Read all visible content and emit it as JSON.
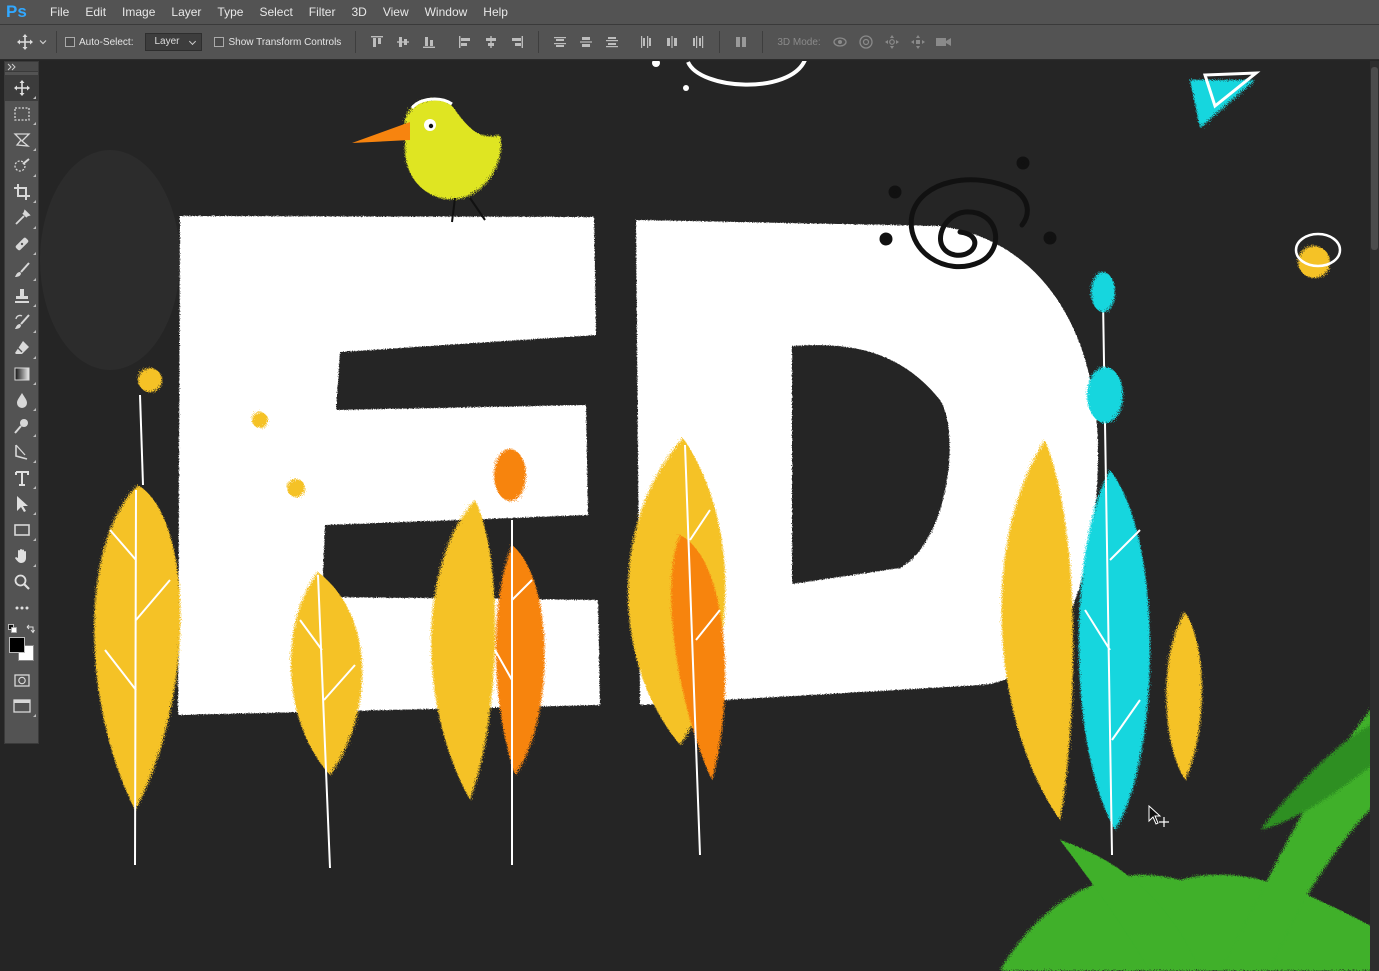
{
  "app": {
    "logo_text": "Ps",
    "accent_color": "#31a8ff"
  },
  "menubar": {
    "items": [
      "File",
      "Edit",
      "Image",
      "Layer",
      "Type",
      "Select",
      "Filter",
      "3D",
      "View",
      "Window",
      "Help"
    ]
  },
  "options": {
    "auto_select_label": "Auto-Select:",
    "auto_select_checked": false,
    "layer_select_value": "Layer",
    "show_transform_label": "Show Transform Controls",
    "show_transform_checked": false,
    "mode_3d_label": "3D Mode:"
  },
  "toolbox": {
    "tools": [
      "move-tool-icon",
      "marquee-tool-icon",
      "lasso-tool-icon",
      "quick-select-tool-icon",
      "crop-tool-icon",
      "eyedropper-tool-icon",
      "healing-brush-tool-icon",
      "brush-tool-icon",
      "clone-stamp-tool-icon",
      "history-brush-tool-icon",
      "eraser-tool-icon",
      "gradient-tool-icon",
      "blur-tool-icon",
      "dodge-tool-icon",
      "pen-tool-icon",
      "type-tool-icon",
      "path-select-tool-icon",
      "rectangle-tool-icon",
      "hand-tool-icon",
      "zoom-tool-icon",
      "more-tools-icon"
    ],
    "active_tool": "move-tool-icon",
    "foreground_color": "#000000",
    "background_color": "#ffffff"
  },
  "canvas": {
    "artwork_text": "ED",
    "colors": {
      "background": "#252525",
      "letters": "#ffffff",
      "yellow": "#f5c228",
      "orange": "#f7840f",
      "cyan": "#19d6de",
      "green": "#3fb02a",
      "bird": "#dfe523"
    }
  }
}
